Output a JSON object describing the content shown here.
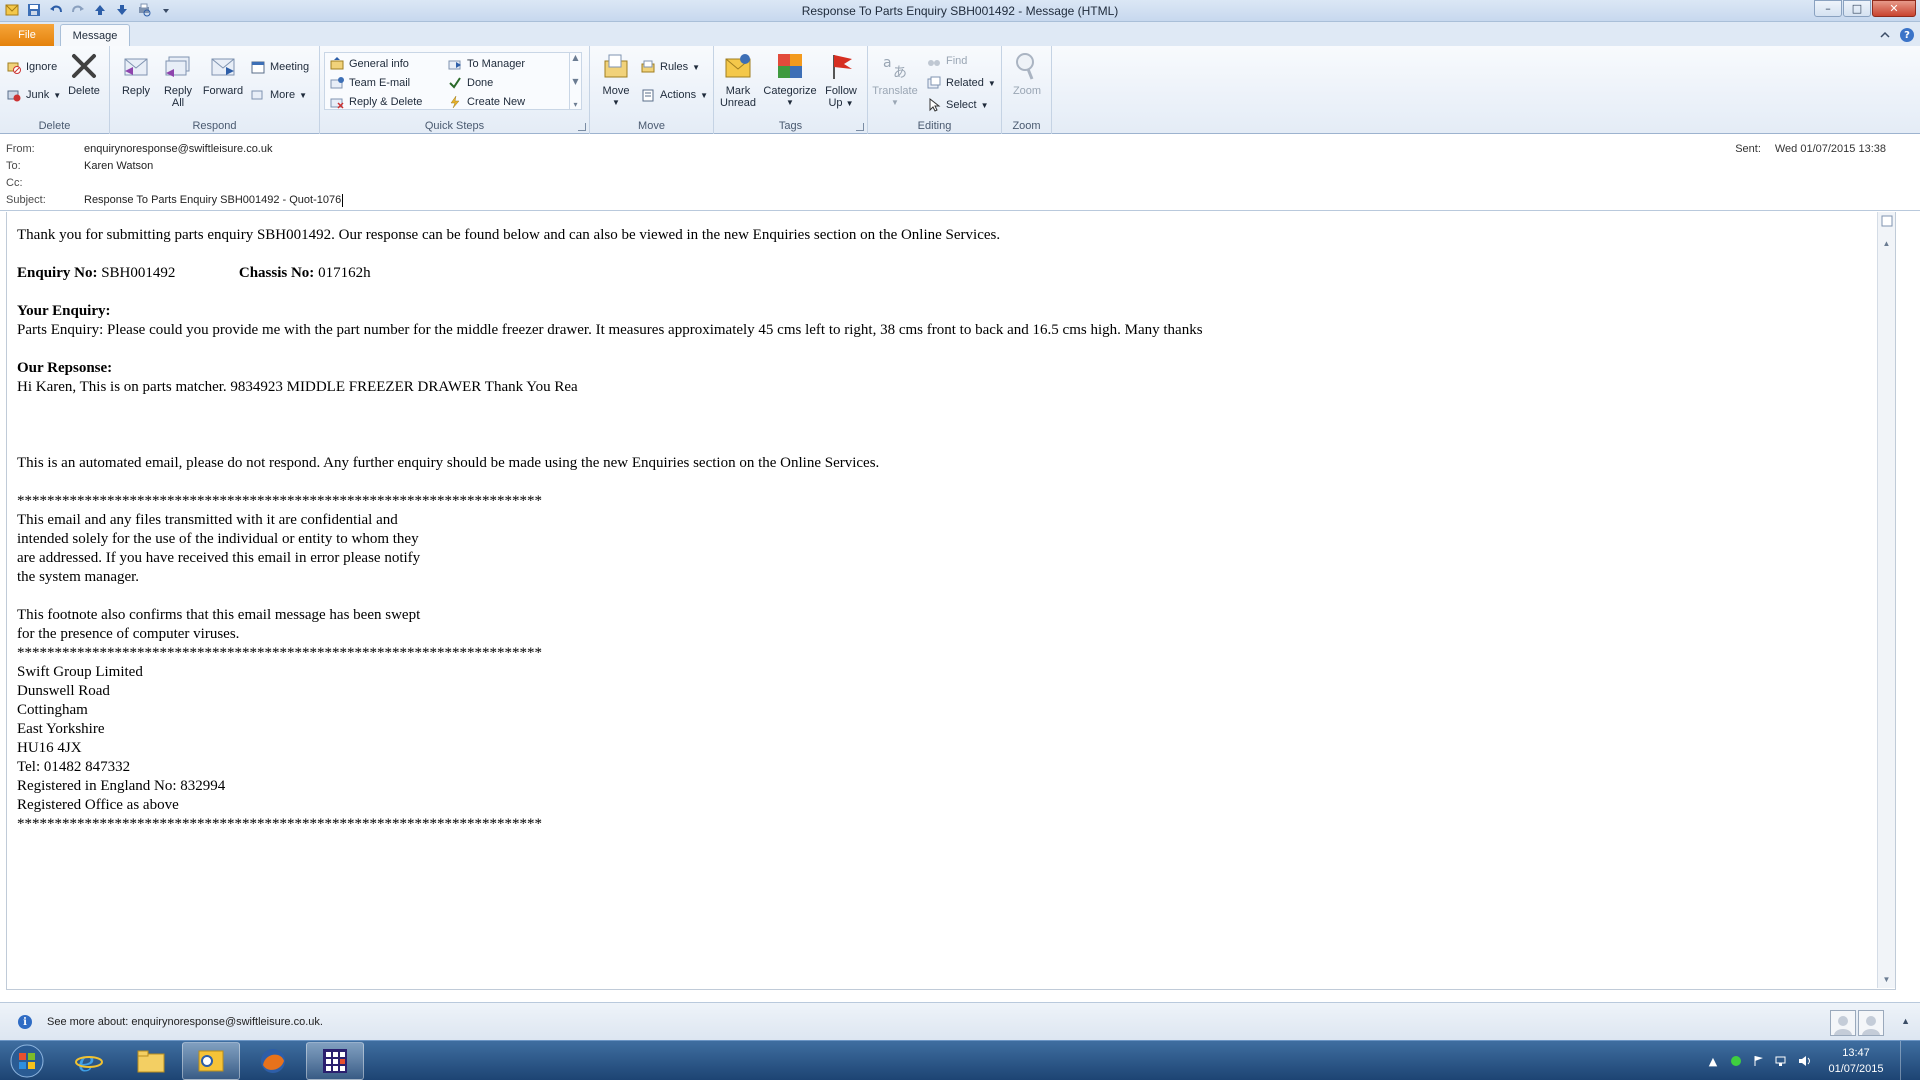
{
  "window": {
    "title": "Response To Parts Enquiry SBH001492 - Message (HTML)",
    "controls": {
      "minimize": "–",
      "maximize": "□",
      "close": "✕"
    }
  },
  "tabs": {
    "file": "File",
    "message": "Message"
  },
  "ribbon": {
    "delete_group": {
      "label": "Delete",
      "ignore": "Ignore",
      "junk": "Junk",
      "delete": "Delete"
    },
    "respond_group": {
      "label": "Respond",
      "reply": "Reply",
      "reply_all_1": "Reply",
      "reply_all_2": "All",
      "forward": "Forward",
      "meeting": "Meeting",
      "more": "More"
    },
    "quicksteps_group": {
      "label": "Quick Steps",
      "items": [
        "General info",
        "Team E-mail",
        "Reply & Delete",
        "To Manager",
        "Done",
        "Create New"
      ]
    },
    "move_group": {
      "label": "Move",
      "move": "Move",
      "rules": "Rules",
      "actions": "Actions"
    },
    "tags_group": {
      "label": "Tags",
      "mark_unread_1": "Mark",
      "mark_unread_2": "Unread",
      "categorize": "Categorize",
      "follow_up_1": "Follow",
      "follow_up_2": "Up"
    },
    "editing_group": {
      "label": "Editing",
      "translate": "Translate",
      "find": "Find",
      "related": "Related",
      "select": "Select"
    },
    "zoom_group": {
      "label": "Zoom",
      "zoom": "Zoom"
    }
  },
  "headers": {
    "from_label": "From:",
    "from": "enquirynoresponse@swiftleisure.co.uk",
    "to_label": "To:",
    "to": "Karen Watson",
    "cc_label": "Cc:",
    "cc": "",
    "subject_label": "Subject:",
    "subject": "Response To Parts Enquiry SBH001492 - Quot-1076",
    "sent_label": "Sent:",
    "sent": "Wed 01/07/2015 13:38"
  },
  "body": {
    "intro": "Thank you for submitting parts enquiry SBH001492. Our response can be found below and can also be viewed in the new Enquiries section on the Online Services.",
    "enquiry_no_label": "Enquiry No:",
    "enquiry_no": "SBH001492",
    "chassis_no_label": "Chassis No:",
    "chassis_no": "017162h",
    "your_enquiry_heading": "Your Enquiry:",
    "your_enquiry": "Parts Enquiry: Please could you provide me with the part number for the middle freezer drawer. It measures approximately 45 cms left to right, 38 cms front to back and 16.5 cms high. Many thanks",
    "our_response_heading": "Our Repsonse:",
    "our_response": "Hi Karen, This is on parts matcher. 9834923 MIDDLE FREEZER DRAWER Thank You Rea",
    "automated_notice": "This is an automated email, please do not respond. Any further enquiry should be made using the new Enquiries section on the Online Services.",
    "stars": "**********************************************************************",
    "disclaimer_lines": [
      "This email and any files transmitted with it are confidential and",
      "intended solely for the use of the individual or entity to whom they",
      "are addressed. If you have received this email in error please notify",
      "the system manager."
    ],
    "footnote_lines": [
      "This footnote also confirms that this email message has been swept",
      "for the presence of computer viruses."
    ],
    "address_lines": [
      "Swift Group Limited",
      "Dunswell Road",
      "Cottingham",
      "East Yorkshire",
      "HU16 4JX",
      "Tel: 01482 847332",
      "Registered in England No: 832994",
      "Registered Office as above"
    ]
  },
  "peoplebar": {
    "see_more": "See more about: enquirynoresponse@swiftleisure.co.uk."
  },
  "taskbar": {
    "apps": [
      "internet-explorer",
      "windows-explorer",
      "outlook",
      "firefox",
      "calculator-app"
    ],
    "clock_time": "13:47",
    "clock_date": "01/07/2015"
  }
}
